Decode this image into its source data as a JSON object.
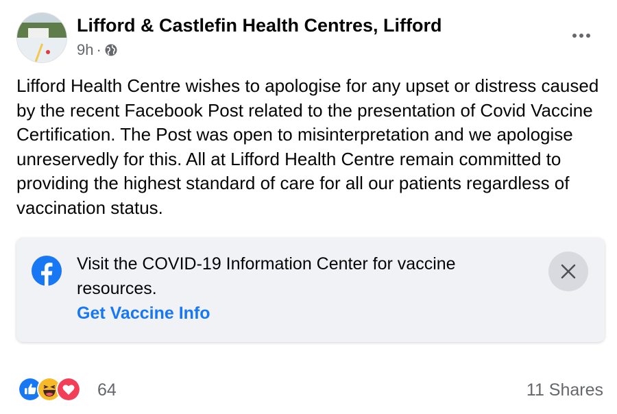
{
  "post": {
    "page_name": "Lifford & Castlefin Health Centres, Lifford",
    "time": "9h",
    "separator": "·",
    "audience_icon": "globe-icon",
    "text": "Lifford Health Centre wishes to apologise for any upset or distress caused by the recent Facebook Post related to the presentation of Covid Vaccine Certification. The Post was open to misinterpretation and we apologise unreservedly for this. All at Lifford Health Centre remain committed to providing the highest standard of care for all our patients regardless of vaccination status."
  },
  "info_card": {
    "icon": "facebook-icon",
    "text": "Visit the COVID-19 Information Center for vaccine resources.",
    "link": "Get Vaccine Info",
    "close_icon": "close-icon"
  },
  "footer": {
    "reactions": [
      "like-icon",
      "haha-icon",
      "love-icon"
    ],
    "reaction_count": "64",
    "shares": "11 Shares"
  },
  "colors": {
    "link": "#1877f2",
    "secondary_text": "#65676b",
    "card_bg": "#f0f2f5"
  }
}
